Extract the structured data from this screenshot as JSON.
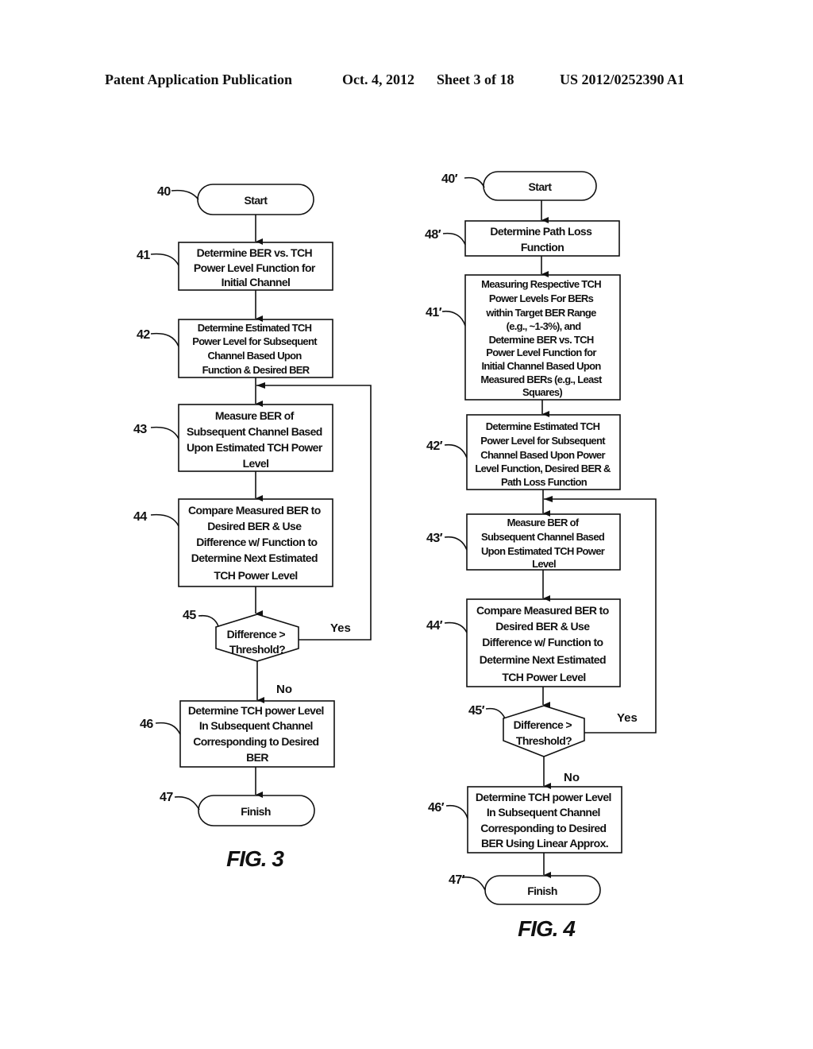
{
  "header": {
    "publication": "Patent Application Publication",
    "date": "Oct. 4, 2012",
    "sheet": "Sheet 3 of 18",
    "number": "US 2012/0252390 A1"
  },
  "fig3": {
    "caption": "FIG. 3",
    "start": {
      "ref": "40",
      "text": "Start"
    },
    "steps": [
      {
        "ref": "41",
        "lines": [
          "Determine BER vs. TCH",
          "Power Level Function for",
          "Initial Channel"
        ]
      },
      {
        "ref": "42",
        "lines": [
          "Determine Estimated TCH",
          "Power Level for Subsequent",
          "Channel Based Upon",
          "Function & Desired BER"
        ]
      },
      {
        "ref": "43",
        "lines": [
          "Measure BER of",
          "Subsequent Channel Based",
          "Upon Estimated TCH Power",
          "Level"
        ]
      },
      {
        "ref": "44",
        "lines": [
          "Compare Measured BER to",
          "Desired BER & Use",
          "Difference w/ Function to",
          "Determine Next Estimated",
          "TCH Power Level"
        ]
      }
    ],
    "decision": {
      "ref": "45",
      "lines": [
        "Difference >",
        "Threshold?"
      ],
      "yes": "Yes",
      "no": "No"
    },
    "final_step": {
      "ref": "46",
      "lines": [
        "Determine TCH power Level",
        "In Subsequent Channel",
        "Corresponding to Desired",
        "BER"
      ]
    },
    "finish": {
      "ref": "47",
      "text": "Finish"
    }
  },
  "fig4": {
    "caption": "FIG. 4",
    "start": {
      "ref": "40′",
      "text": "Start"
    },
    "steps": [
      {
        "ref": "48′",
        "lines": [
          "Determine Path Loss",
          "Function"
        ]
      },
      {
        "ref": "41′",
        "lines": [
          "Measuring Respective TCH",
          "Power Levels For BERs",
          "within Target BER Range",
          "(e.g., ~1-3%), and",
          "Determine BER vs. TCH",
          "Power Level Function for",
          "Initial Channel Based Upon",
          "Measured BERs (e.g., Least",
          "Squares)"
        ]
      },
      {
        "ref": "42′",
        "lines": [
          "Determine Estimated TCH",
          "Power Level for Subsequent",
          "Channel Based Upon Power",
          "Level Function, Desired BER &",
          "Path Loss Function"
        ]
      },
      {
        "ref": "43′",
        "lines": [
          "Measure BER of",
          "Subsequent Channel Based",
          "Upon Estimated TCH Power",
          "Level"
        ]
      },
      {
        "ref": "44′",
        "lines": [
          "Compare Measured BER to",
          "Desired BER & Use",
          "Difference w/ Function to",
          "Determine Next Estimated",
          "TCH Power Level"
        ]
      }
    ],
    "decision": {
      "ref": "45′",
      "lines": [
        "Difference >",
        "Threshold?"
      ],
      "yes": "Yes",
      "no": "No"
    },
    "final_step": {
      "ref": "46′",
      "lines": [
        "Determine TCH power Level",
        "In Subsequent Channel",
        "Corresponding to Desired",
        "BER Using Linear Approx."
      ]
    },
    "finish": {
      "ref": "47′",
      "text": "Finish"
    }
  }
}
